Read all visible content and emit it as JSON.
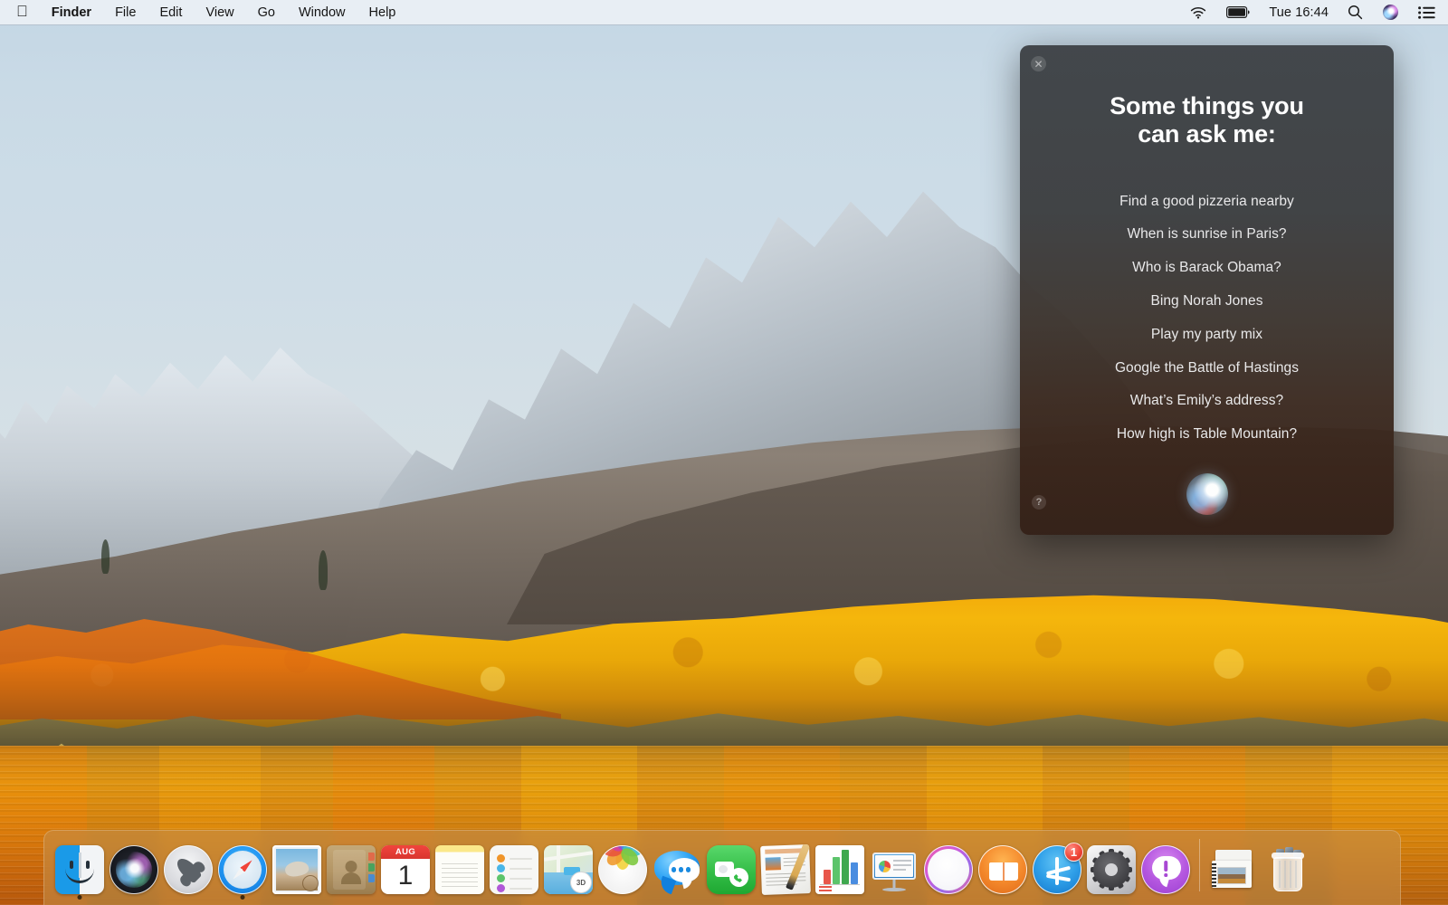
{
  "menubar": {
    "apple_logo": "apple-logo",
    "app_name": "Finder",
    "items": [
      "File",
      "Edit",
      "View",
      "Go",
      "Window",
      "Help"
    ],
    "status": {
      "wifi_icon": "wifi-icon",
      "battery_icon": "battery-icon",
      "clock": "Tue 16:44",
      "spotlight_icon": "search-icon",
      "siri_icon": "siri-icon",
      "notification_center_icon": "list-icon"
    }
  },
  "siri_panel": {
    "close_label": "✕",
    "help_label": "?",
    "title_line1": "Some things you",
    "title_line2": "can ask me:",
    "suggestions": [
      "Find a good pizzeria nearby",
      "When is sunrise in Paris?",
      "Who is Barack Obama?",
      "Bing Norah Jones",
      "Play my party mix",
      "Google the Battle of Hastings",
      "What’s Emily’s address?",
      "How high is Table Mountain?"
    ],
    "orb_label": "siri-orb"
  },
  "dock": {
    "items": [
      {
        "name": "Finder",
        "icon": "finder-icon",
        "running": true
      },
      {
        "name": "Siri",
        "icon": "siri-icon",
        "running": false
      },
      {
        "name": "Launchpad",
        "icon": "launchpad-icon",
        "running": false
      },
      {
        "name": "Safari",
        "icon": "safari-icon",
        "running": true
      },
      {
        "name": "Mail",
        "icon": "mail-icon",
        "running": false
      },
      {
        "name": "Contacts",
        "icon": "contacts-icon",
        "running": false
      },
      {
        "name": "Calendar",
        "icon": "calendar-icon",
        "running": false,
        "month": "AUG",
        "day": "1"
      },
      {
        "name": "Notes",
        "icon": "notes-icon",
        "running": false
      },
      {
        "name": "Reminders",
        "icon": "reminders-icon",
        "running": false
      },
      {
        "name": "Maps",
        "icon": "maps-icon",
        "running": false,
        "badge_text": "3D"
      },
      {
        "name": "Photos",
        "icon": "photos-icon",
        "running": false
      },
      {
        "name": "Messages",
        "icon": "messages-icon",
        "running": false
      },
      {
        "name": "FaceTime",
        "icon": "facetime-icon",
        "running": false
      },
      {
        "name": "Pages",
        "icon": "pages-icon",
        "running": false
      },
      {
        "name": "Numbers",
        "icon": "numbers-icon",
        "running": false
      },
      {
        "name": "Keynote",
        "icon": "keynote-icon",
        "running": false
      },
      {
        "name": "iTunes",
        "icon": "itunes-icon",
        "running": false
      },
      {
        "name": "iBooks",
        "icon": "ibooks-icon",
        "running": false
      },
      {
        "name": "App Store",
        "icon": "app-store-icon",
        "running": false,
        "badge": "1"
      },
      {
        "name": "System Preferences",
        "icon": "system-preferences-icon",
        "running": false
      },
      {
        "name": "Alert",
        "icon": "alert-icon",
        "running": false
      }
    ],
    "right_items": [
      {
        "name": "Downloads Stack",
        "icon": "downloads-stack-icon"
      },
      {
        "name": "Trash",
        "icon": "trash-icon"
      }
    ]
  },
  "desktop": {
    "wallpaper_name": "High Sierra mountain lake",
    "sky_color": "#c9dae6",
    "foliage_color": "#f2a80a",
    "lake_color": "#d8870f"
  }
}
